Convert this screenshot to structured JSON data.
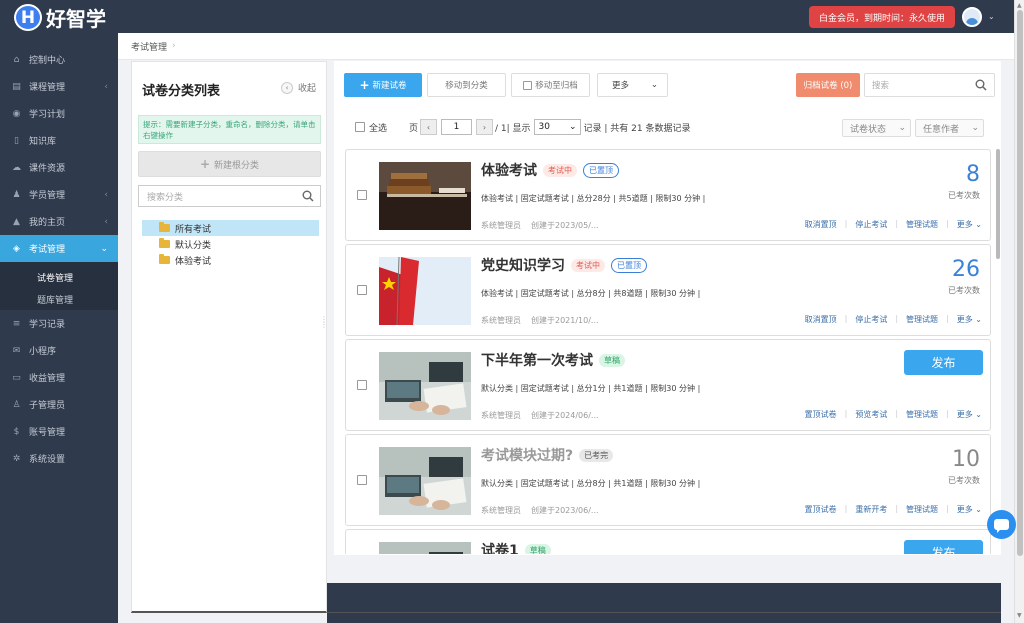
{
  "app": {
    "logo_letter": "H",
    "logo_text": "好智学",
    "vip_text": "白金会员，到期时间：永久使用"
  },
  "colors": {
    "topbar": "#2f3a4c",
    "accent": "#3aa6ee",
    "danger": "#e04343",
    "archive": "#f18b6e"
  },
  "sidebar": {
    "items": [
      {
        "label": "控制中心",
        "icon": "home-icon"
      },
      {
        "label": "课程管理",
        "icon": "book-icon",
        "arrow": true
      },
      {
        "label": "学习计划",
        "icon": "eye-icon"
      },
      {
        "label": "知识库",
        "icon": "doc-icon"
      },
      {
        "label": "课件资源",
        "icon": "cloud-icon"
      },
      {
        "label": "学员管理",
        "icon": "users-icon",
        "arrow": true
      },
      {
        "label": "我的主页",
        "icon": "cap-icon",
        "arrow": true
      },
      {
        "label": "考试管理",
        "icon": "tag-icon",
        "arrow": true,
        "active": true
      },
      {
        "label": "学习记录",
        "icon": "list-icon"
      },
      {
        "label": "小程序",
        "icon": "chat-icon"
      },
      {
        "label": "收益管理",
        "icon": "card-icon"
      },
      {
        "label": "子管理员",
        "icon": "user-icon"
      },
      {
        "label": "账号管理",
        "icon": "dollar-icon"
      },
      {
        "label": "系统设置",
        "icon": "gear-icon"
      }
    ],
    "sub_items": [
      "试卷管理",
      "题库管理"
    ]
  },
  "breadcrumb": {
    "current": "考试管理",
    "sep": "›"
  },
  "categories": {
    "title": "试卷分类列表",
    "collapse_label": "收起",
    "tip": "提示：需要新建子分类，重命名，删除分类，请单击右键操作",
    "new_root_label": "新建根分类",
    "search_placeholder": "搜索分类",
    "tree": [
      "所有考试",
      "默认分类",
      "体验考试"
    ]
  },
  "toolbar": {
    "new_label": "新建试卷",
    "move_label": "移动到分类",
    "archive_move_label": "移动至归档",
    "more_label": "更多",
    "archived_label": "归档试卷 (0)",
    "search_placeholder": "搜索"
  },
  "pagination": {
    "select_all": "全选",
    "page_label": "页",
    "current_page": "1",
    "total_pages_text": "/ 1| 显示",
    "page_size": "30",
    "records_text": "记录 | 共有 21 条数据记录"
  },
  "filters": {
    "status": "试卷状态",
    "author": "任意作者"
  },
  "exams": [
    {
      "title": "体验考试",
      "tags": [
        {
          "text": "考试中",
          "kind": "live"
        },
        {
          "text": "已置顶",
          "kind": "pinned"
        }
      ],
      "meta": "体验考试 | 固定试题考试 | 总分28分 | 共5道题 | 限制30 分钟 |",
      "author": "系统管理员",
      "created": "创建于2023/05/...",
      "count": "8",
      "count_label": "已考次数",
      "count_color": "#3b82d6",
      "actions": [
        "取消置顶",
        "停止考试",
        "管理试题",
        "更多 ⌄"
      ]
    },
    {
      "title": "党史知识学习",
      "tags": [
        {
          "text": "考试中",
          "kind": "live"
        },
        {
          "text": "已置顶",
          "kind": "pinned"
        }
      ],
      "meta": "体验考试 | 固定试题考试 | 总分8分 | 共8道题 | 限制30 分钟 |",
      "author": "系统管理员",
      "created": "创建于2021/10/...",
      "count": "26",
      "count_label": "已考次数",
      "count_color": "#3b82d6",
      "actions": [
        "取消置顶",
        "停止考试",
        "管理试题",
        "更多 ⌄"
      ]
    },
    {
      "title": "下半年第一次考试",
      "tags": [
        {
          "text": "草稿",
          "kind": "draft"
        }
      ],
      "meta": "默认分类 | 固定试题考试 | 总分1分 | 共1道题 | 限制30 分钟 |",
      "author": "系统管理员",
      "created": "创建于2024/06/...",
      "publish": "发布",
      "actions": [
        "置顶试卷",
        "预览考试",
        "管理试题",
        "更多 ⌄"
      ]
    },
    {
      "title": "考试模块过期?",
      "tags": [
        {
          "text": "已考完",
          "kind": "done"
        }
      ],
      "meta": "默认分类 | 固定试题考试 | 总分8分 | 共1道题 | 限制30 分钟 |",
      "author": "系统管理员",
      "created": "创建于2023/06/...",
      "count": "10",
      "count_label": "已考次数",
      "count_color": "#888",
      "actions": [
        "置顶试卷",
        "重新开考",
        "管理试题",
        "更多 ⌄"
      ]
    },
    {
      "title": "试卷1",
      "tags": [
        {
          "text": "草稿",
          "kind": "draft"
        }
      ],
      "publish": "发布"
    }
  ]
}
